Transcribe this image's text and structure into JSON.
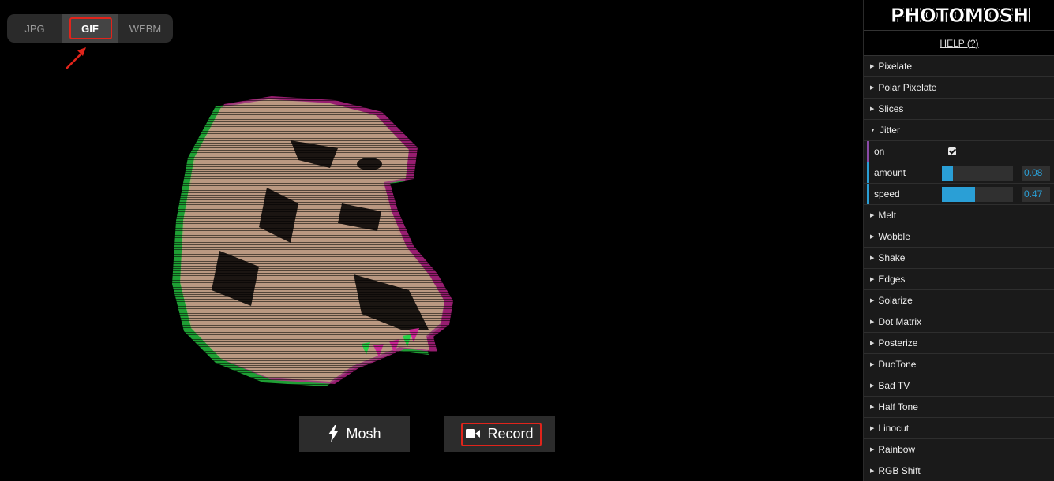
{
  "format_tabs": [
    {
      "label": "JPG",
      "active": false
    },
    {
      "label": "GIF",
      "active": true
    },
    {
      "label": "WEBM",
      "active": false
    }
  ],
  "actions": {
    "mosh_label": "Mosh",
    "record_label": "Record"
  },
  "panel": {
    "logo": "PHOTOMOSH",
    "help": "HELP (?)",
    "effects_before": [
      "Pixelate",
      "Polar Pixelate",
      "Slices"
    ],
    "expanded_effect": {
      "label": "Jitter",
      "params": {
        "on_label": "on",
        "on_checked": true,
        "amount_label": "amount",
        "amount_value": "0.08",
        "amount_fraction": 0.08,
        "speed_label": "speed",
        "speed_value": "0.47",
        "speed_fraction": 0.47
      }
    },
    "effects_after": [
      "Melt",
      "Wobble",
      "Shake",
      "Edges",
      "Solarize",
      "Dot Matrix",
      "Posterize",
      "DuoTone",
      "Bad TV",
      "Half Tone",
      "Linocut",
      "Rainbow",
      "RGB Shift"
    ]
  },
  "colors": {
    "accent": "#2a9fd6",
    "highlight": "#e0241b",
    "glitch_magenta": "#d62a9e",
    "glitch_green": "#2be04a"
  }
}
